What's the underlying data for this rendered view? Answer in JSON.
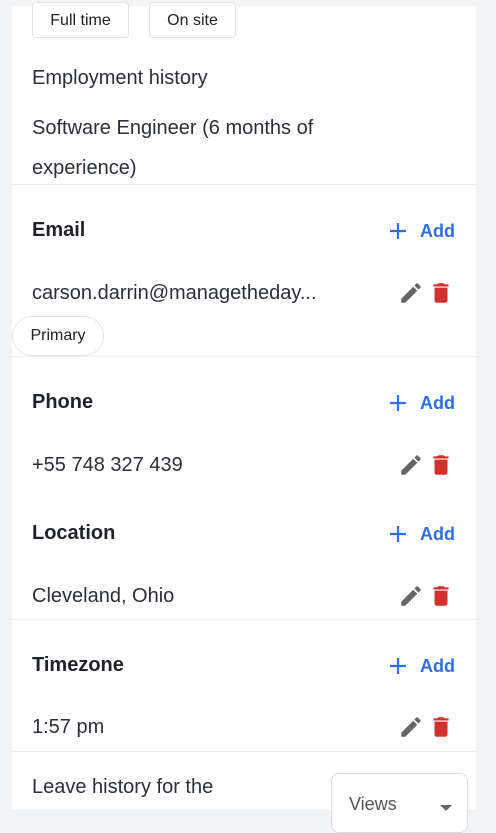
{
  "tags": {
    "employment_type": "Full time",
    "work_mode": "On site"
  },
  "employment_history": {
    "label": "Employment history",
    "entry_line1": "Software Engineer (6 months of",
    "entry_line2": "experience)"
  },
  "email": {
    "title": "Email",
    "add_label": "Add",
    "value": "carson.darrin@managetheday...",
    "badge": "Primary"
  },
  "phone": {
    "title": "Phone",
    "add_label": "Add",
    "value": "+55 748 327 439"
  },
  "location": {
    "title": "Location",
    "add_label": "Add",
    "value": "Cleveland, Ohio"
  },
  "timezone": {
    "title": "Timezone",
    "add_label": "Add",
    "value": "1:57 pm"
  },
  "leave_history": {
    "label": "Leave history for the",
    "select_value": "Views"
  },
  "colors": {
    "accent": "#2f6fdf",
    "delete": "#d32f2f",
    "edit": "#666666"
  },
  "icons": {
    "add": "plus-icon",
    "edit": "pencil-icon",
    "delete": "trash-icon",
    "select": "caret-down-icon"
  }
}
